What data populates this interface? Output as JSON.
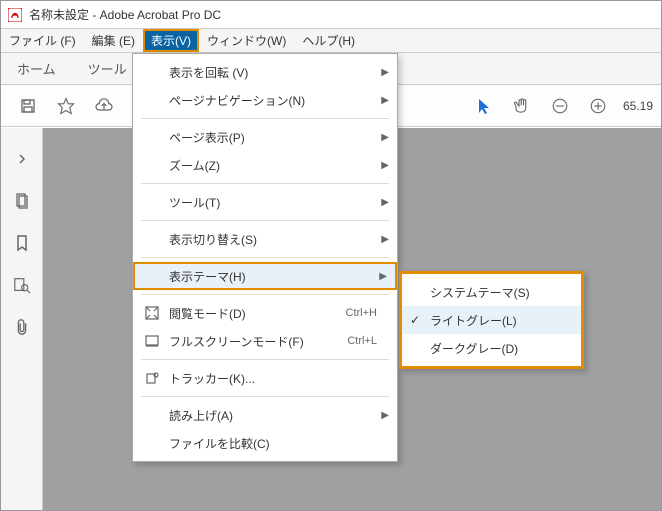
{
  "window": {
    "title": "名称未設定 - Adobe Acrobat Pro DC"
  },
  "menubar": {
    "file": "ファイル (F)",
    "edit": "編集 (E)",
    "view": "表示(V)",
    "window": "ウィンドウ(W)",
    "help": "ヘルプ(H)"
  },
  "tabs": {
    "home": "ホーム",
    "tools": "ツール"
  },
  "toolbar": {
    "zoom_value": "65.19"
  },
  "view_menu": {
    "rotate_view": "表示を回転 (V)",
    "page_nav": "ページナビゲーション(N)",
    "page_display": "ページ表示(P)",
    "zoom": "ズーム(Z)",
    "tools": "ツール(T)",
    "show_hide": "表示切り替え(S)",
    "display_theme": "表示テーマ(H)",
    "reading_mode": "閲覧モード(D)",
    "reading_mode_accel": "Ctrl+H",
    "fullscreen": "フルスクリーンモード(F)",
    "fullscreen_accel": "Ctrl+L",
    "tracker": "トラッカー(K)...",
    "read_aloud": "読み上げ(A)",
    "compare": "ファイルを比較(C)"
  },
  "theme_submenu": {
    "system": "システムテーマ(S)",
    "light_gray": "ライトグレー(L)",
    "dark_gray": "ダークグレー(D)"
  }
}
